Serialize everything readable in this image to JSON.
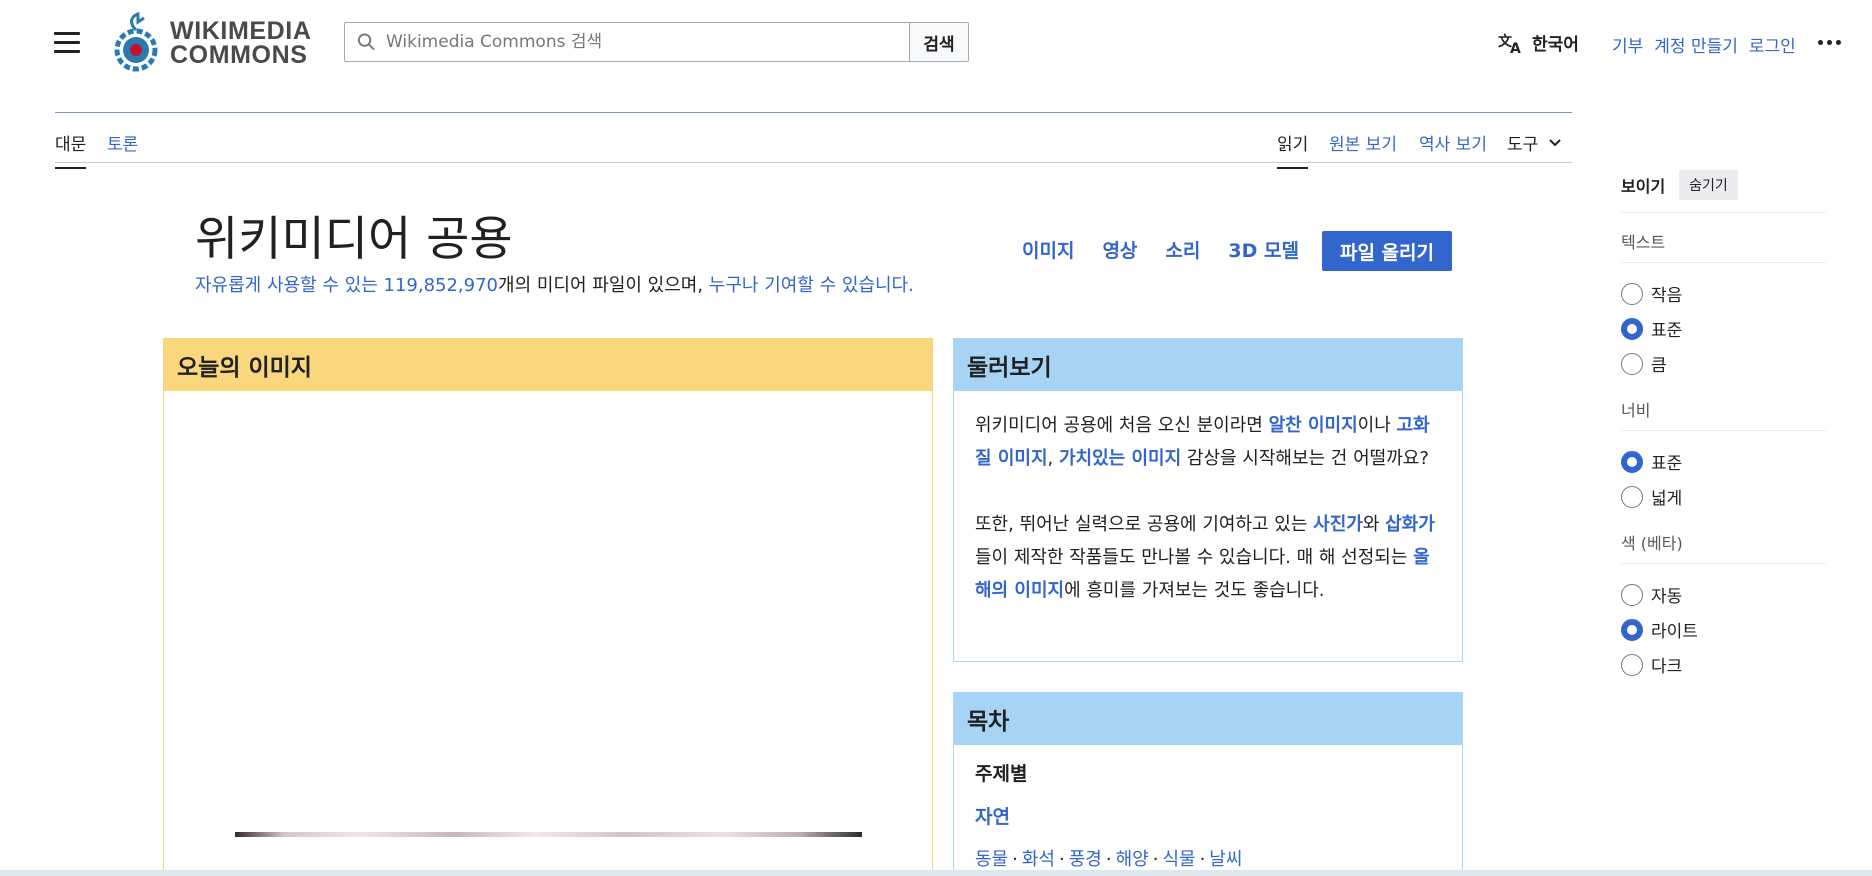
{
  "header": {
    "logo_line1": "WIKIMEDIA",
    "logo_line2": "COMMONS",
    "search_placeholder": "Wikimedia Commons 검색",
    "search_button": "검색",
    "language_label": "한국어",
    "user_links": [
      "기부",
      "계정 만들기",
      "로그인"
    ]
  },
  "tabs": {
    "left": [
      "대문",
      "토론"
    ],
    "right": [
      "읽기",
      "원본 보기",
      "역사 보기",
      "도구"
    ]
  },
  "main": {
    "title": "위키미디어 공용",
    "subtitle_link1": "자유롭게 사용할 수 있는",
    "subtitle_count": "119,852,970",
    "subtitle_mid": "개의 미디어 파일이 있으며, ",
    "subtitle_link2": "누구나 기여할 수 있습니다",
    "subtitle_end": ".",
    "media_types": [
      "이미지",
      "영상",
      "소리",
      "3D 모델"
    ],
    "upload_button": "파일 올리기"
  },
  "potd": {
    "heading": "오늘의 이미지"
  },
  "browse": {
    "heading": "둘러보기",
    "p1_a": "위키미디어 공용에 처음 오신 분이라면 ",
    "p1_link1": "알찬 이미지",
    "p1_b": "이나",
    "p1_link2": "고화질 이미지",
    "p1_c": ", ",
    "p1_link3": "가치있는 이미지",
    "p1_d": " 감상을 시작해보는 건 어떨까요?",
    "p2_a": "또한, 뛰어난 실력으로 공용에 기여하고 있는 ",
    "p2_link1": "사진가",
    "p2_b": "와 ",
    "p2_link2": "삽화가",
    "p2_c": "들이 제작한 작품들도 만나볼 수 있습니다. 매 해 선정되는 ",
    "p2_link3": "올해의 이미지",
    "p2_d": "에 흥미를 가져보는 것도 좋습니다."
  },
  "toc": {
    "heading": "목차",
    "section": "주제별",
    "topic": "자연",
    "subtopics": [
      "동물",
      "화석",
      "풍경",
      "해양",
      "식물",
      "날씨"
    ],
    "separator": "·"
  },
  "appearance": {
    "title": "보이기",
    "hide_button": "숨기기",
    "text_title": "텍스트",
    "text_options": [
      "작음",
      "표준",
      "큼"
    ],
    "width_title": "너비",
    "width_options": [
      "표준",
      "넓게"
    ],
    "color_title": "색 (베타)",
    "color_options": [
      "자동",
      "라이트",
      "다크"
    ]
  },
  "colors": {
    "accent": "#3366cc",
    "potd_header": "#fad67d",
    "blue_header": "#a7d4f4"
  }
}
